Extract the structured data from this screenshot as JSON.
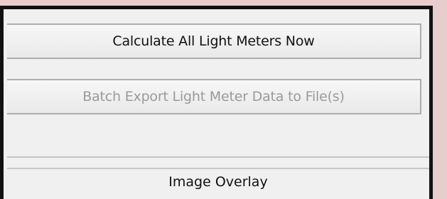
{
  "buttons": {
    "calculate_all": "Calculate All Light Meters Now",
    "batch_export": "Batch Export Light Meter Data to File(s)"
  },
  "sections": {
    "image_overlay": "Image Overlay"
  },
  "colors": {
    "background": "#e8cdcd",
    "panel": "#f0f0f0",
    "frame": "#111111",
    "disabled_text": "#9a9a9a"
  }
}
